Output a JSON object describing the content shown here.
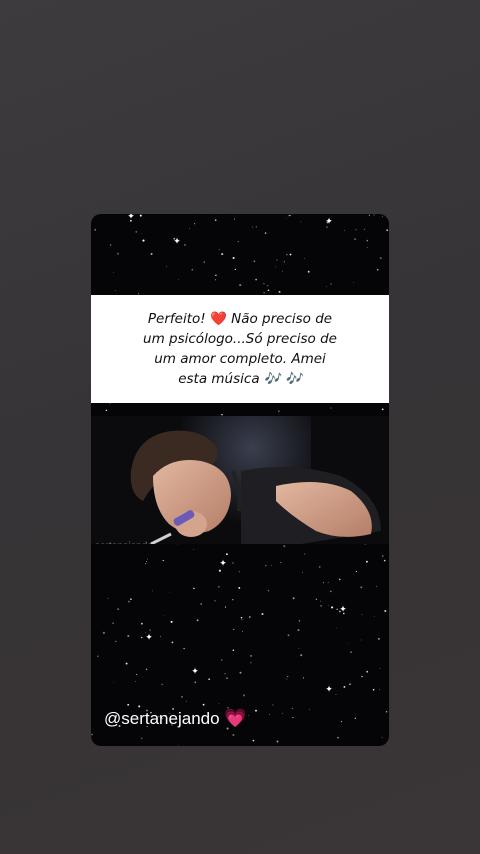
{
  "story": {
    "quote_lines": [
      "Perfeito!",
      "Não preciso de",
      "um psicólogo...Só preciso de",
      "um amor completo.  Amei",
      "esta música 🎶 🎶"
    ],
    "heart_emoji": "❤️",
    "watermark": "sertanejando",
    "mention": "@sertanejando",
    "mention_emoji": "💗"
  },
  "colors": {
    "background": "#373537",
    "card": "#050507",
    "quote_box": "#ffffff",
    "heart_red": "#e0112b",
    "heart_pink": "#ff3f8e"
  }
}
